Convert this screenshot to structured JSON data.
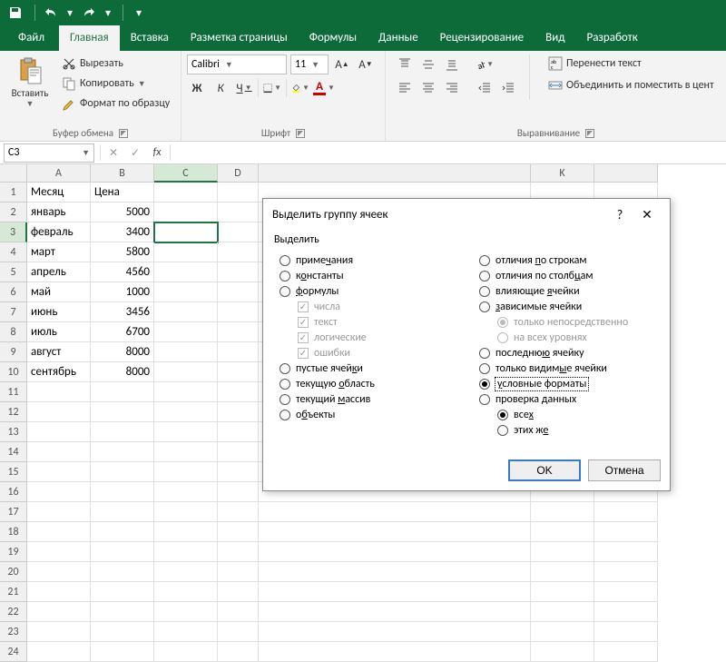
{
  "qat": {
    "save": "save",
    "undo": "undo",
    "redo": "redo"
  },
  "ribbon_tabs": {
    "file": "Файл",
    "home": "Главная",
    "insert": "Вставка",
    "layout": "Разметка страницы",
    "formulas": "Формулы",
    "data": "Данные",
    "review": "Рецензирование",
    "view": "Вид",
    "developer": "Разработк"
  },
  "clipboard": {
    "paste": "Вставить",
    "cut": "Вырезать",
    "copy": "Копировать",
    "format_painter": "Формат по образцу",
    "group_label": "Буфер обмена"
  },
  "font": {
    "name": "Calibri",
    "size": "11",
    "group_label": "Шрифт",
    "bold": "Ж",
    "italic": "К",
    "underline": "Ч"
  },
  "alignment": {
    "wrap": "Перенести текст",
    "merge": "Объединить и поместить в цент",
    "group_label": "Выравнивание"
  },
  "namebox": "C3",
  "columns": [
    "A",
    "B",
    "C",
    "D",
    "",
    "K",
    ""
  ],
  "sheet": {
    "headers": {
      "A": "Месяц",
      "B": "Цена"
    },
    "rows": [
      {
        "A": "январь",
        "B": "5000"
      },
      {
        "A": "февраль",
        "B": "3400"
      },
      {
        "A": "март",
        "B": "5800"
      },
      {
        "A": "апрель",
        "B": "4560"
      },
      {
        "A": "май",
        "B": "1000"
      },
      {
        "A": "июнь",
        "B": "3456"
      },
      {
        "A": "июль",
        "B": "6700"
      },
      {
        "A": "август",
        "B": "8000"
      },
      {
        "A": "сентябрь",
        "B": "8000"
      }
    ]
  },
  "dialog": {
    "title": "Выделить группу ячеек",
    "heading": "Выделить",
    "left": {
      "notes": "примечания",
      "constants": "константы",
      "formulas": "формулы",
      "numbers": "числа",
      "text": "текст",
      "logicals": "логические",
      "errors": "ошибки",
      "blanks": "пустые ячейки",
      "current_region": "текущую область",
      "current_array": "текущий массив",
      "objects": "объекты"
    },
    "right": {
      "row_diffs": "отличия по строкам",
      "col_diffs": "отличия по столбцам",
      "precedents": "влияющие ячейки",
      "dependents": "зависимые ячейки",
      "direct_only": "только непосредственно",
      "all_levels": "на всех уровнях",
      "last_cell": "последнюю ячейку",
      "visible_only": "только видимые ячейки",
      "cond_formats": "условные форматы",
      "data_validation": "проверка данных",
      "all": "всех",
      "same": "этих же"
    },
    "ok": "OK",
    "cancel": "Отмена",
    "help": "?",
    "close": "✕"
  }
}
